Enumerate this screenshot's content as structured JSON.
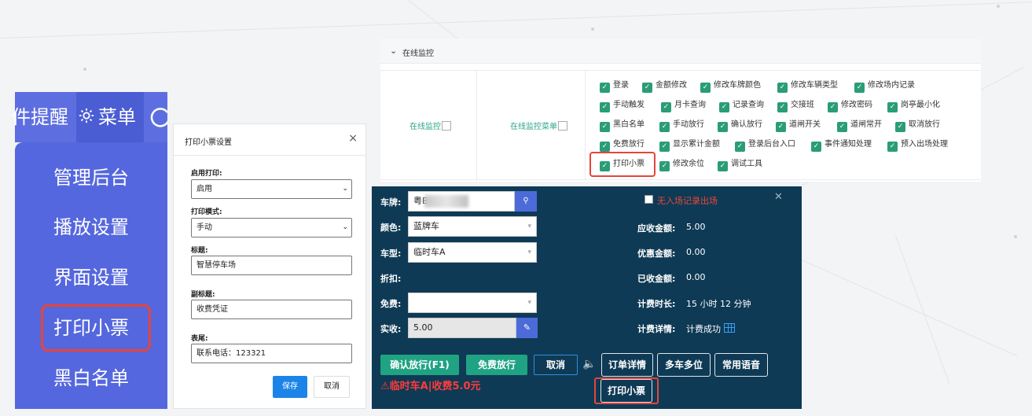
{
  "menu": {
    "topbar": {
      "alert_label": "件提醒",
      "menu_label": "菜单"
    },
    "items": [
      "管理后台",
      "播放设置",
      "界面设置",
      "打印小票",
      "黑白名单"
    ]
  },
  "print_dialog": {
    "title": "打印小票设置",
    "close": "×",
    "fields": [
      {
        "label": "启用打印:",
        "value": "启用",
        "type": "select"
      },
      {
        "label": "打印模式:",
        "value": "手动",
        "type": "select"
      },
      {
        "label": "标题:",
        "value": "智慧停车场",
        "type": "input"
      },
      {
        "label": "副标题:",
        "value": "收费凭证",
        "type": "input"
      },
      {
        "label": "表尾:",
        "value": "联系电话：123321",
        "type": "input"
      }
    ],
    "save_label": "保存",
    "cancel_label": "取消"
  },
  "permissions": {
    "section_title": "在线监控",
    "group_label": "在线监控",
    "menu_label": "在线监控菜单",
    "rows": [
      [
        "登录",
        "金额修改",
        "修改车牌颜色",
        "修改车辆类型",
        "修改场内记录"
      ],
      [
        "手动触发",
        "月卡查询",
        "记录查询",
        "交接班",
        "修改密码",
        "岗亭最小化"
      ],
      [
        "黑白名单",
        "手动放行",
        "确认放行",
        "道闸开关",
        "道闸常开",
        "取消放行"
      ],
      [
        "免费放行",
        "显示累计金额",
        "登录后台入口",
        "事件通知处理",
        "预入出场处理"
      ],
      [
        "打印小票",
        "修改余位",
        "调试工具"
      ]
    ]
  },
  "operator": {
    "plate_label": "车牌:",
    "plate_value": "粤B",
    "color_label": "颜色:",
    "color_value": "蓝牌车",
    "type_label": "车型:",
    "type_value": "临时车A",
    "discount_label": "折扣:",
    "free_label": "免费:",
    "free_value": "",
    "paid_label": "实收:",
    "paid_value": "5.00",
    "no_entry_label": "无入场记录出场",
    "receivable_label": "应收金额:",
    "receivable_value": "5.00",
    "preferential_label": "优惠金额:",
    "preferential_value": "0.00",
    "received_label": "已收金额:",
    "received_value": "0.00",
    "duration_label": "计费时长:",
    "duration_value": "15 小时 12 分钟",
    "detail_label": "计费详情:",
    "detail_value": "计费成功",
    "buttons": {
      "confirm": "确认放行(F1)",
      "free": "免费放行",
      "cancel": "取消",
      "order_detail": "订单详情",
      "multi_car": "多车多位",
      "common_voice": "常用语音",
      "print_ticket": "打印小票"
    },
    "warning": "⚠临时车A|收费5.0元"
  }
}
